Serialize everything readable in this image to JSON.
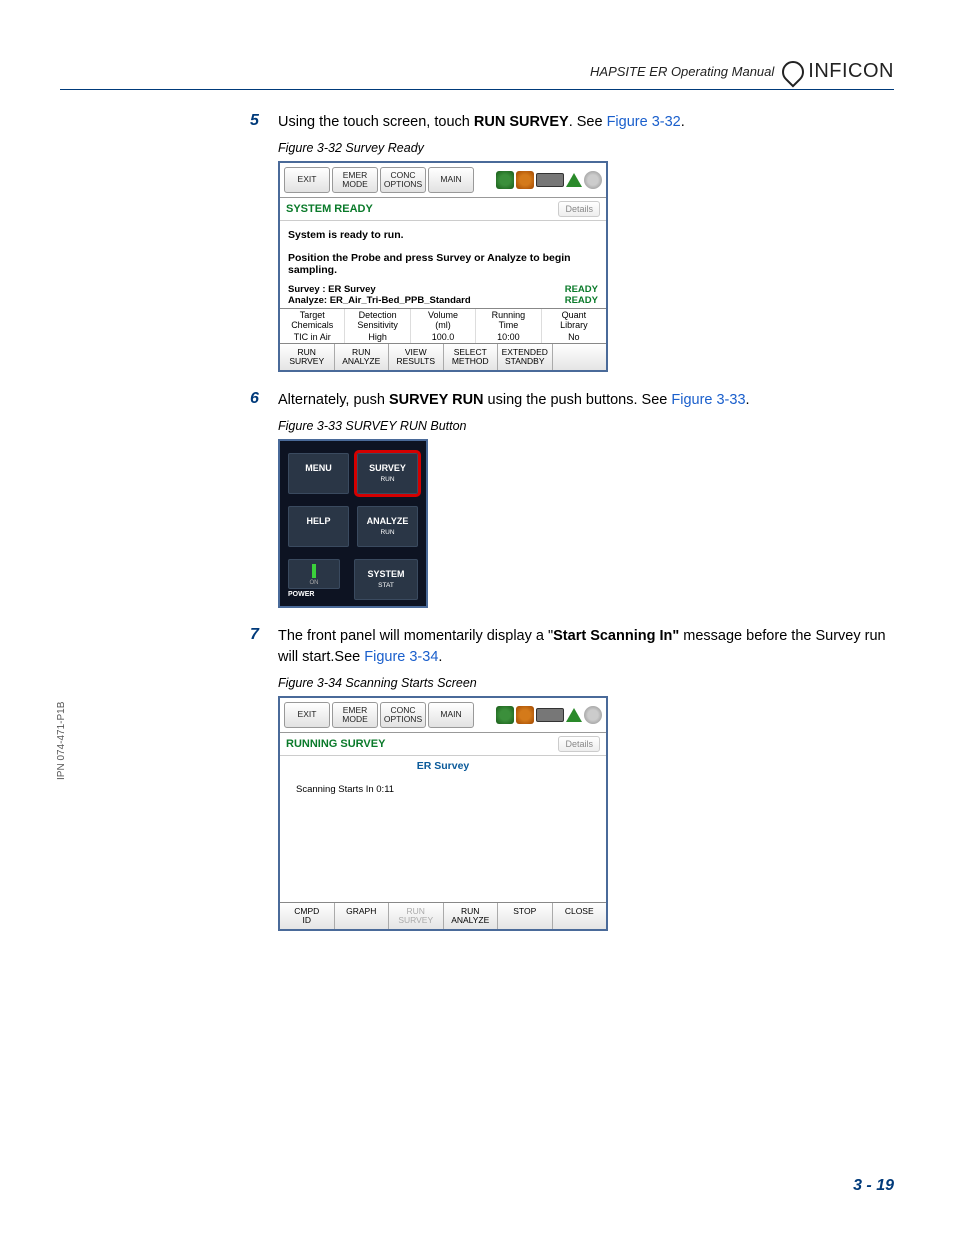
{
  "header": {
    "manual_title": "HAPSITE ER Operating Manual",
    "brand": "INFICON"
  },
  "side_ipn": "IPN 074-471-P1B",
  "page_number": "3 - 19",
  "steps": {
    "s5": {
      "num": "5",
      "pre": "Using the touch screen, touch ",
      "bold": "RUN SURVEY",
      "post": ". See ",
      "link": "Figure 3-32",
      "end": "."
    },
    "s6": {
      "num": "6",
      "pre": "Alternately, push ",
      "bold": "SURVEY RUN",
      "post": " using the push buttons. See ",
      "link": "Figure 3-33",
      "end": "."
    },
    "s7": {
      "num": "7",
      "pre": "The front panel will momentarily display a \"",
      "bold": "Start Scanning In\"",
      "post": " message before the Survey run will start.See ",
      "link": "Figure 3-34",
      "end": "."
    }
  },
  "fig32": {
    "caption": "Figure 3-32  Survey Ready",
    "top": {
      "exit": "EXIT",
      "emer": "EMER\nMODE",
      "conc": "CONC\nOPTIONS",
      "main": "MAIN"
    },
    "status": "SYSTEM READY",
    "details": "Details",
    "body_line1": "System is ready to run.",
    "body_line2": "Position the Probe and press Survey or Analyze to begin sampling.",
    "survey_label": "Survey : ER Survey",
    "analyze_label": "Analyze: ER_Air_Tri-Bed_PPB_Standard",
    "ready": "READY",
    "table": {
      "h": [
        "Target\nChemicals",
        "Detection\nSensitivity",
        "Volume\n(ml)",
        "Running\nTime",
        "Quant\nLibrary"
      ],
      "r": [
        "TIC in Air",
        "High",
        "100.0",
        "10:00",
        "No"
      ]
    },
    "bottom": [
      "RUN\nSURVEY",
      "RUN\nANALYZE",
      "VIEW\nRESULTS",
      "SELECT\nMETHOD",
      "EXTENDED\nSTANDBY",
      ""
    ]
  },
  "fig33": {
    "caption": "Figure 3-33  SURVEY RUN Button",
    "buttons": {
      "menu": "MENU",
      "survey": "SURVEY",
      "survey_sub": "RUN",
      "help": "HELP",
      "analyze": "ANALYZE",
      "analyze_sub": "RUN",
      "on": "ON",
      "system": "SYSTEM",
      "system_sub": "STAT",
      "power": "POWER"
    }
  },
  "fig34": {
    "caption": "Figure 3-34  Scanning Starts Screen",
    "top": {
      "exit": "EXIT",
      "emer": "EMER\nMODE",
      "conc": "CONC\nOPTIONS",
      "main": "MAIN"
    },
    "status": "RUNNING SURVEY",
    "details": "Details",
    "title": "ER Survey",
    "body": "Scanning Starts In  0:11",
    "bottom": [
      "CMPD\nID",
      "GRAPH",
      "RUN\nSURVEY",
      "RUN\nANALYZE",
      "STOP",
      "CLOSE"
    ]
  }
}
